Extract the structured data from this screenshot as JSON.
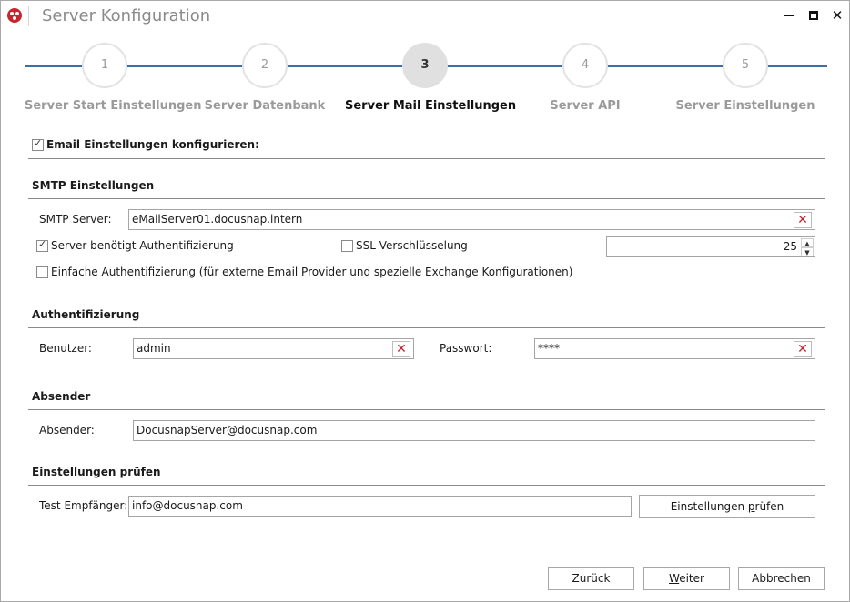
{
  "window": {
    "title": "Server Konfiguration"
  },
  "stepper": {
    "steps": [
      {
        "number": "1",
        "label": "Server Start Einstellungen"
      },
      {
        "number": "2",
        "label": "Server Datenbank"
      },
      {
        "number": "3",
        "label": "Server Mail Einstellungen"
      },
      {
        "number": "4",
        "label": "Server API"
      },
      {
        "number": "5",
        "label": "Server Einstellungen"
      }
    ],
    "active_step": "3"
  },
  "email_config": {
    "label": "Email Einstellungen konfigurieren:",
    "checked": true
  },
  "smtp": {
    "header": "SMTP Einstellungen",
    "server_label": "SMTP Server:",
    "server_value": "eMailServer01.docusnap.intern",
    "auth_required_label": "Server benötigt Authentifizierung",
    "auth_required_checked": true,
    "ssl_label": "SSL Verschlüsselung",
    "ssl_checked": false,
    "port_value": "25",
    "simple_auth_label": "Einfache Authentifizierung (für externe Email Provider und spezielle Exchange Konfigurationen)",
    "simple_auth_checked": false
  },
  "auth": {
    "header": "Authentifizierung",
    "user_label": "Benutzer:",
    "user_value": "admin",
    "password_label": "Passwort:",
    "password_value": "****"
  },
  "sender": {
    "header": "Absender",
    "label": "Absender:",
    "value": "DocusnapServer@docusnap.com"
  },
  "test": {
    "header": "Einstellungen prüfen",
    "recipient_label": "Test Empfänger:",
    "recipient_value": "info@docusnap.com",
    "check_button_pre": "Einstellungen ",
    "check_button_ul": "p",
    "check_button_post": "rüfen"
  },
  "footer": {
    "back_label": "Zurück",
    "next_ul": "W",
    "next_rest": "eiter",
    "cancel_label": "Abbrechen"
  },
  "colors": {
    "accent_line": "#3d6ea8",
    "clear_x": "#c0262d"
  },
  "icons": {
    "app": "docusnap-logo-icon",
    "clear": "clear-x-icon",
    "check": "checkmark-icon"
  }
}
